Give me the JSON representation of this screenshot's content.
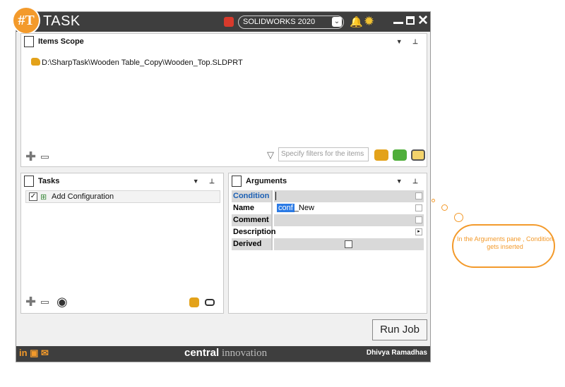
{
  "app": {
    "logo_text": "#T",
    "title": "TASK"
  },
  "header": {
    "version": "SOLIDWORKS 2020",
    "chevron": "⌄"
  },
  "items_scope": {
    "title": "Items Scope",
    "path": "D:\\SharpTask\\Wooden Table_Copy\\Wooden_Top.SLDPRT",
    "filter_placeholder": "Specify filters for the items"
  },
  "tasks": {
    "title": "Tasks",
    "items": [
      {
        "label": "Add Configuration",
        "checked": "✓"
      }
    ]
  },
  "arguments": {
    "title": "Arguments",
    "rows": [
      {
        "key": "Condition",
        "value": ""
      },
      {
        "key": "Name",
        "value_highlight": "conf",
        "value_rest": "_New"
      },
      {
        "key": "Comment",
        "value": ""
      },
      {
        "key": "Description",
        "value": ""
      },
      {
        "key": "Derived",
        "value": ""
      }
    ]
  },
  "actions": {
    "run_label": "Run Job"
  },
  "footer": {
    "social": "in ▣ ✉",
    "brand_bold": "central",
    "brand_rest": " innovation",
    "author": "Dhivya Ramadhas"
  },
  "callout": {
    "text": "In the Arguments pane , Condition gets inserted"
  },
  "colors": {
    "accent": "#f39a2b",
    "titlebar": "#3e3e3e",
    "highlight": "#2c7be5"
  }
}
